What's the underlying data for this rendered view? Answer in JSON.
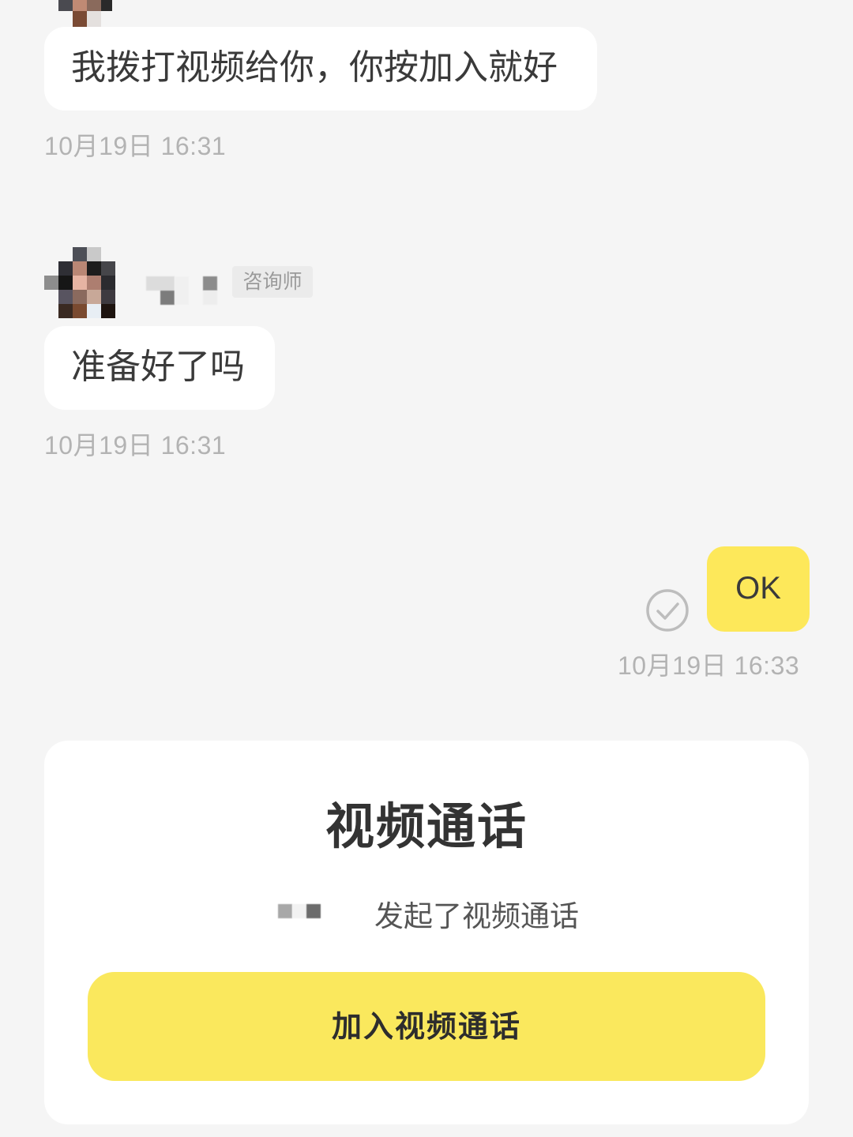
{
  "messages": [
    {
      "id": "msg1",
      "direction": "incoming",
      "text": "我拨打视频给你，你按加入就好",
      "timestamp": "10月19日 16:31"
    },
    {
      "id": "msg2",
      "direction": "incoming",
      "sender_role": "咨询师",
      "text": "准备好了吗",
      "timestamp": "10月19日 16:31"
    },
    {
      "id": "msg3",
      "direction": "outgoing",
      "text": "OK",
      "status_icon": "check-circle-icon",
      "timestamp": "10月19日 16:33"
    }
  ],
  "call_card": {
    "title": "视频通话",
    "subtitle": "发起了视频通话",
    "join_label": "加入视频通话"
  },
  "colors": {
    "background": "#f5f5f5",
    "incoming_bubble": "#ffffff",
    "outgoing_bubble": "#fde85a",
    "join_button": "#fae85d",
    "timestamp": "#b3b3b3"
  }
}
